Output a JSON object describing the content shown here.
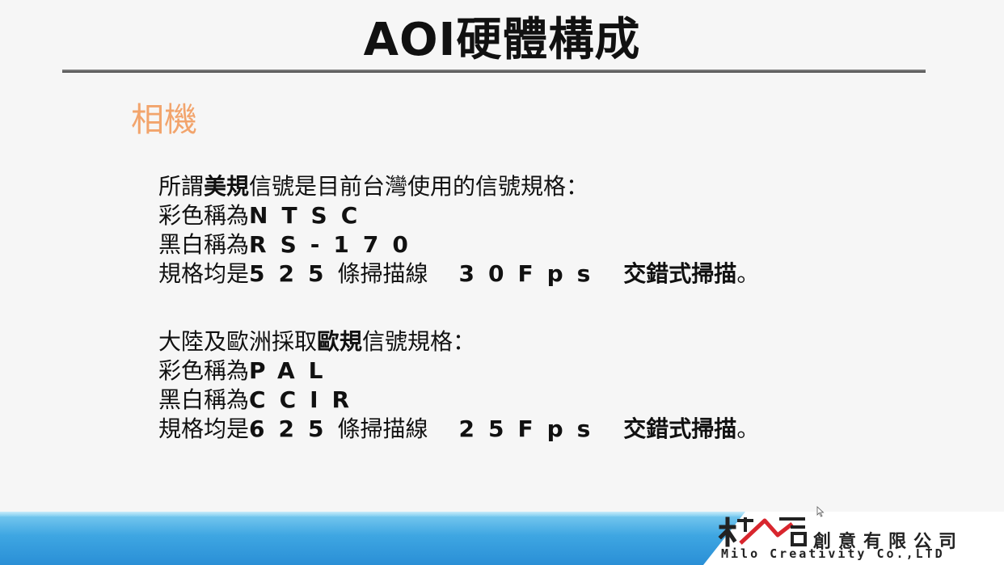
{
  "slide": {
    "title": "AOI硬體構成",
    "section_heading": "相機",
    "ntsc_block": {
      "intro_prefix": "所謂",
      "intro_bold": "美規",
      "intro_suffix": "信號是目前台灣使用的信號規格：",
      "color_label": "彩色稱為",
      "color_value": "NTSC",
      "bw_label": "黑白稱為",
      "bw_value": "RS-170",
      "spec_label": "規格均是",
      "spec_lines": "525",
      "spec_unit": "條掃描線",
      "spec_fps": "30Fps",
      "spec_scan": "交錯式掃描",
      "spec_end": "。"
    },
    "pal_block": {
      "intro_prefix": "大陸及歐洲採取",
      "intro_bold": "歐規",
      "intro_suffix": "信號規格：",
      "color_label": "彩色稱為",
      "color_value": "PAL",
      "bw_label": "黑白稱為",
      "bw_value": "CCIR",
      "spec_label": "規格均是",
      "spec_lines": "625",
      "spec_unit": "條掃描線",
      "spec_fps": "25Fps",
      "spec_scan": "交錯式掃描",
      "spec_end": "。"
    }
  },
  "footer": {
    "company_name": "創意有限公司",
    "company_name_en": "Milo Creativity Co.,LTD"
  },
  "colors": {
    "heading_accent": "#f2a46c",
    "band_blue": "#3ea6e2",
    "logo_red": "#d8262e",
    "logo_dark": "#222222"
  }
}
